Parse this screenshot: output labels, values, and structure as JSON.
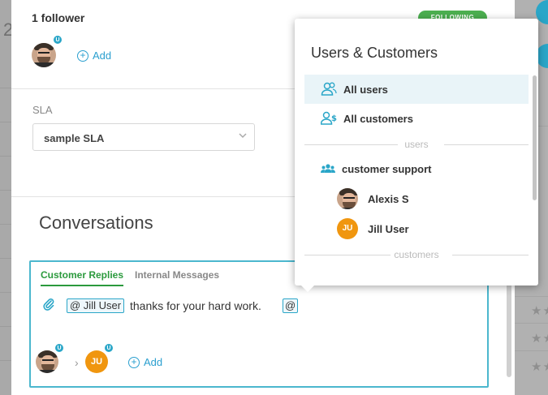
{
  "followers": {
    "title": "1 follower",
    "status_badge": "FOLLOWING",
    "add_label": "Add",
    "avatar_badge": "U"
  },
  "background": {
    "left_digit": "2"
  },
  "sla": {
    "label": "SLA",
    "selected": "sample SLA"
  },
  "conversations": {
    "title": "Conversations",
    "tabs": [
      {
        "label": "Customer Replies",
        "active": true
      },
      {
        "label": "Internal Messages",
        "active": false
      }
    ],
    "mention": "@ Jill User",
    "message": "thanks for your hard work.",
    "trailing_mention": "@",
    "participants": [
      {
        "type": "photo",
        "badge": "U"
      },
      {
        "type": "initials",
        "initials": "JU",
        "badge": "U"
      }
    ],
    "add_label": "Add"
  },
  "dropdown": {
    "title": "Users & Customers",
    "items": [
      {
        "label": "All users",
        "icon": "users-icon",
        "selected": true
      },
      {
        "label": "All customers",
        "icon": "customers-icon",
        "selected": false
      }
    ],
    "sections": [
      {
        "label": "users"
      },
      {
        "label": "customers"
      }
    ],
    "group": {
      "label": "customer support",
      "icon": "group-icon"
    },
    "users": [
      {
        "name": "Alexis S",
        "avatar": "photo"
      },
      {
        "name": "Jill User",
        "avatar": "initials",
        "initials": "JU"
      }
    ]
  },
  "colors": {
    "accent": "#2aa6c8",
    "active_tab": "#2b9a3d",
    "following_badge": "#4caf50",
    "initials_avatar": "#f0960f",
    "selected_row": "#e9f4f8"
  }
}
